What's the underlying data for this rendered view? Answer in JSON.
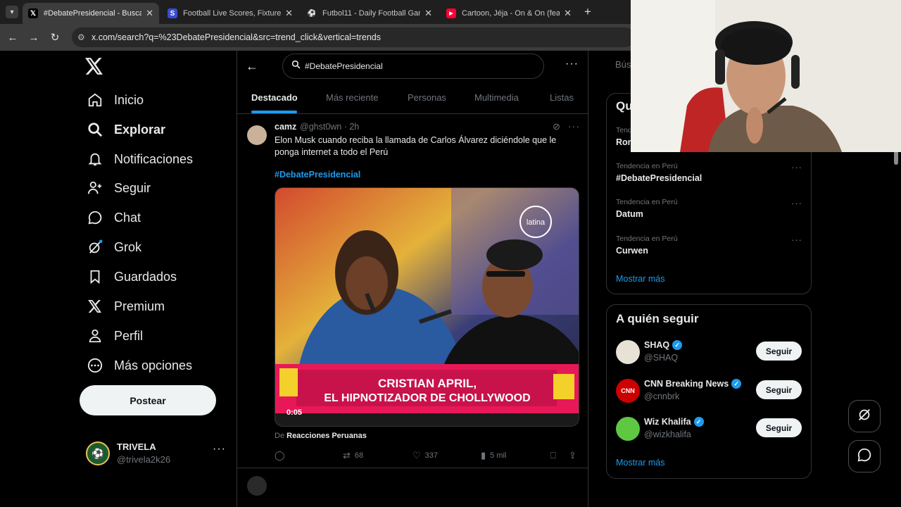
{
  "browser": {
    "tabs": [
      {
        "title": "#DebatePresidencial - Buscar / X",
        "icon": "x-logo"
      },
      {
        "title": "Football Live Scores, Fixtures & Results",
        "icon": "sofascore-icon"
      },
      {
        "title": "Futbol11 - Daily Football Games",
        "icon": "futbol11-icon"
      },
      {
        "title": "Cartoon, Jéja - On & On (feat. Daniel Levi)",
        "icon": "youtube-icon"
      }
    ],
    "new_tab": "+",
    "url": "x.com/search?q=%23DebatePresidencial&src=trend_click&vertical=trends"
  },
  "sidebar": {
    "items": [
      {
        "label": "Inicio",
        "icon": "home-icon"
      },
      {
        "label": "Explorar",
        "icon": "search-icon"
      },
      {
        "label": "Notificaciones",
        "icon": "bell-icon"
      },
      {
        "label": "Seguir",
        "icon": "follow-icon"
      },
      {
        "label": "Chat",
        "icon": "chat-icon"
      },
      {
        "label": "Grok",
        "icon": "grok-icon"
      },
      {
        "label": "Guardados",
        "icon": "bookmark-icon"
      },
      {
        "label": "Premium",
        "icon": "x-icon"
      },
      {
        "label": "Perfil",
        "icon": "person-icon"
      },
      {
        "label": "Más opciones",
        "icon": "more-icon"
      }
    ],
    "post_button": "Postear",
    "account": {
      "name": "TRIVELA",
      "handle": "@trivela2k26",
      "more": "···"
    }
  },
  "search": {
    "query": "#DebatePresidencial",
    "more": "···"
  },
  "search_tabs": [
    "Destacado",
    "Más reciente",
    "Personas",
    "Multimedia",
    "Listas"
  ],
  "tweet": {
    "name": "camz",
    "handle": "@ghst0wn · 2h",
    "text": "Elon Musk cuando reciba la llamada de Carlos Álvarez diciéndole que le ponga internet a todo el Perú",
    "hashtag": "#DebatePresidencial",
    "video": {
      "time": "0:05",
      "watermark": "latina",
      "banner_line1": "CRISTIAN APRIL,",
      "banner_line2": "EL HIPNOTIZADOR DE CHOLLYWOOD",
      "source_prefix": "De ",
      "source": "Reacciones Peruanas"
    },
    "actions": {
      "retweets": "68",
      "likes": "337",
      "views": "5 mil"
    }
  },
  "right": {
    "search_partial": "Bús",
    "trends_title_partial": "Qu",
    "trends": [
      {
        "context": "Tendenc",
        "name": "Ron"
      },
      {
        "context": "Tendencia en Perú",
        "name": "#DebatePresidencial"
      },
      {
        "context": "Tendencia en Perú",
        "name": "Datum"
      },
      {
        "context": "Tendencia en Perú",
        "name": "Curwen"
      }
    ],
    "trends_more": "Mostrar más",
    "who_title": "A quién seguir",
    "who": [
      {
        "name": "SHAQ",
        "handle": "@SHAQ",
        "button": "Seguir",
        "avatar_color": "#e8e1d6"
      },
      {
        "name": "CNN Breaking News",
        "handle": "@cnnbrk",
        "button": "Seguir",
        "avatar_color": "#cc0000",
        "avatar_text": "CNN"
      },
      {
        "name": "Wiz Khalifa",
        "handle": "@wizkhalifa",
        "button": "Seguir",
        "avatar_color": "#5fc843"
      }
    ],
    "who_more": "Mostrar más"
  },
  "colors": {
    "accent": "#1d9bf0",
    "background": "#000000",
    "border": "#2f3336",
    "muted": "#71767b"
  }
}
